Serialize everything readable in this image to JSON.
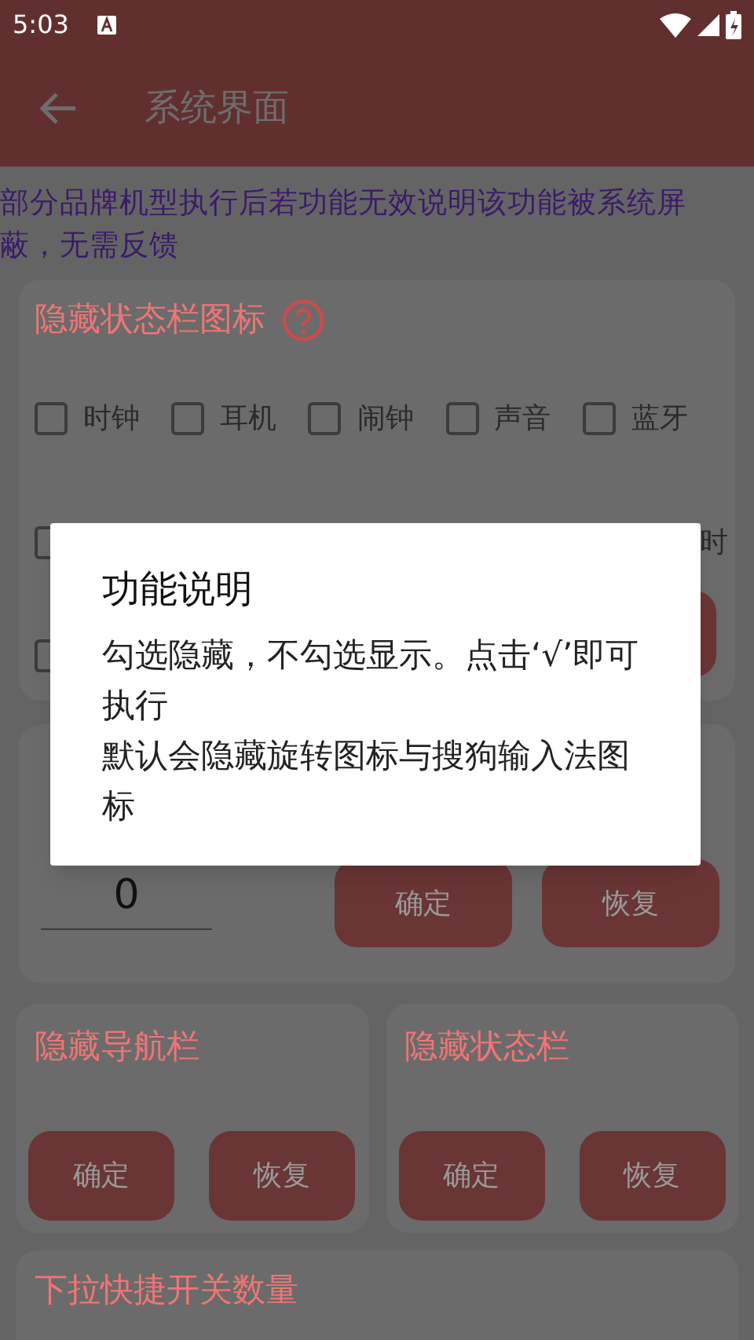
{
  "status_bar": {
    "time": "5:03"
  },
  "app_bar": {
    "title": "系统界面"
  },
  "notice": "部分品牌机型执行后若功能无效说明该功能被系统屏蔽，无需反馈",
  "status_icons_card": {
    "title": "隐藏状态栏图标",
    "items": [
      {
        "label": "时钟",
        "checked": false
      },
      {
        "label": "耳机",
        "checked": false
      },
      {
        "label": "闹钟",
        "checked": false
      },
      {
        "label": "声音",
        "checked": false
      },
      {
        "label": "蓝牙",
        "checked": false
      }
    ],
    "covered_label": "时"
  },
  "nav_card": {
    "value": "0",
    "buttons": [
      "确定",
      "恢复"
    ]
  },
  "pair_cards": [
    {
      "title": "隐藏导航栏",
      "buttons": [
        "确定",
        "恢复"
      ]
    },
    {
      "title": "隐藏状态栏",
      "buttons": [
        "确定",
        "恢复"
      ]
    }
  ],
  "toggle_count_card": {
    "title": "下拉快捷开关数量"
  },
  "dialog": {
    "title": "功能说明",
    "lines": [
      "勾选隐藏，不勾选显示。点击‘√’即可执行",
      "默认会隐藏旋转图标与搜狗输入法图标"
    ]
  }
}
